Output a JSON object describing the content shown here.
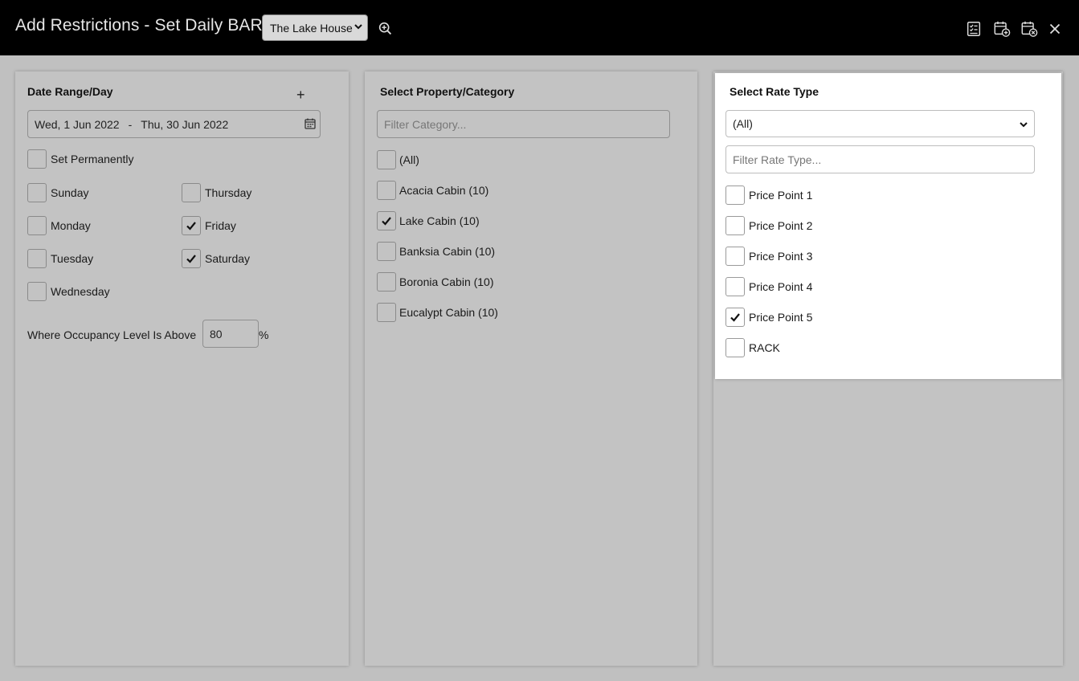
{
  "header": {
    "title": "Add Restrictions - Set Daily BAR",
    "property_selected": "The Lake House",
    "icons": [
      "zoom-in-icon",
      "checklist-icon",
      "save-calendar-icon",
      "save-cancel-calendar-icon",
      "close-icon"
    ]
  },
  "date_panel": {
    "title": "Date Range/Day",
    "add_label": "+",
    "date_start": "Wed, 1 Jun 2022",
    "date_separator": "-",
    "date_end": "Thu, 30 Jun 2022",
    "set_permanently": {
      "label": "Set Permanently",
      "checked": false
    },
    "days": [
      {
        "label": "Sunday",
        "checked": false
      },
      {
        "label": "Monday",
        "checked": false
      },
      {
        "label": "Tuesday",
        "checked": false
      },
      {
        "label": "Wednesday",
        "checked": false
      },
      {
        "label": "Thursday",
        "checked": false
      },
      {
        "label": "Friday",
        "checked": true
      },
      {
        "label": "Saturday",
        "checked": true
      }
    ],
    "occupancy_label": "Where Occupancy Level Is Above",
    "occupancy_value": "80",
    "occupancy_unit": "%"
  },
  "category_panel": {
    "title": "Select Property/Category",
    "filter_placeholder": "Filter Category...",
    "items": [
      {
        "label": "(All)",
        "checked": false
      },
      {
        "label": "Acacia Cabin (10)",
        "checked": false
      },
      {
        "label": "Lake Cabin (10)",
        "checked": true
      },
      {
        "label": "Banksia Cabin (10)",
        "checked": false
      },
      {
        "label": "Boronia Cabin (10)",
        "checked": false
      },
      {
        "label": "Eucalypt Cabin (10)",
        "checked": false
      }
    ]
  },
  "rate_panel": {
    "title": "Select Rate Type",
    "select_value": "(All)",
    "filter_placeholder": "Filter Rate Type...",
    "items": [
      {
        "label": "Price Point 1",
        "checked": false
      },
      {
        "label": "Price Point 2",
        "checked": false
      },
      {
        "label": "Price Point 3",
        "checked": false
      },
      {
        "label": "Price Point 4",
        "checked": false
      },
      {
        "label": "Price Point 5",
        "checked": true
      },
      {
        "label": "RACK",
        "checked": false
      }
    ]
  },
  "colors": {
    "header_bg": "#000000",
    "page_bg": "#c0c0c0",
    "panel_bg": "#c3c3c3",
    "active_panel_bg": "#ffffff"
  }
}
